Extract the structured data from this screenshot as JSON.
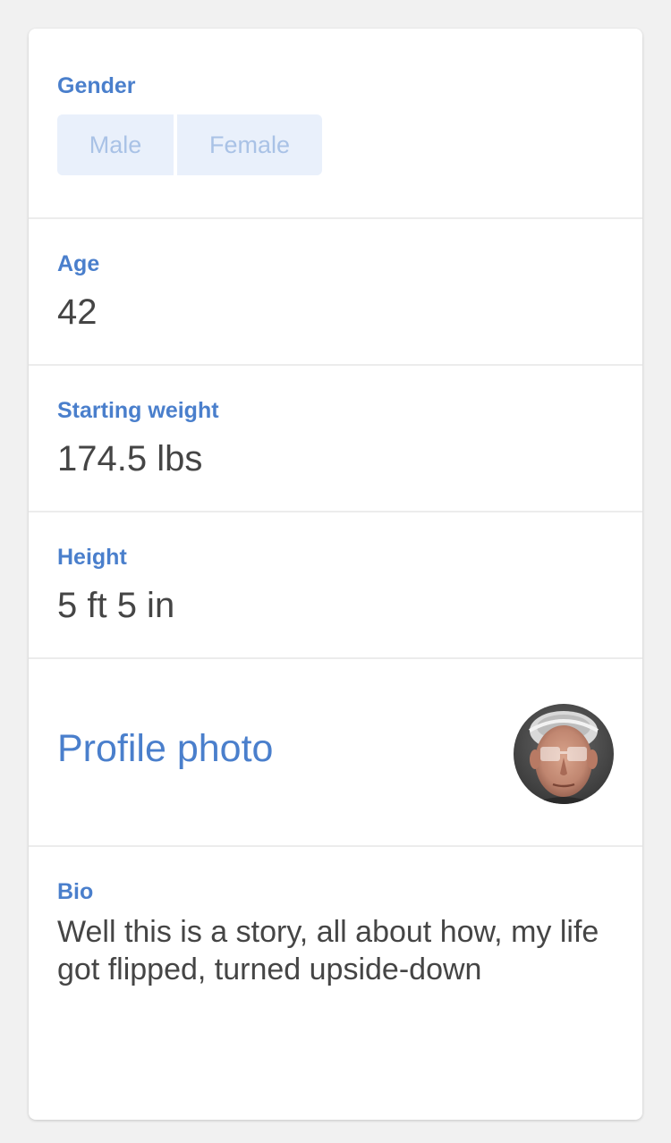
{
  "gender": {
    "label": "Gender",
    "options": [
      "Male",
      "Female"
    ]
  },
  "age": {
    "label": "Age",
    "value": "42"
  },
  "starting_weight": {
    "label": "Starting weight",
    "value": "174.5 lbs"
  },
  "height": {
    "label": "Height",
    "value": "5 ft 5 in"
  },
  "profile_photo": {
    "label": "Profile photo"
  },
  "bio": {
    "label": "Bio",
    "text": "Well this is a story, all about how, my life got flipped, turned upside-down"
  },
  "colors": {
    "accent": "#4a7fcc",
    "toggle_bg": "#e9f0fb",
    "toggle_text": "#a9c2e6",
    "value_text": "#454545"
  }
}
